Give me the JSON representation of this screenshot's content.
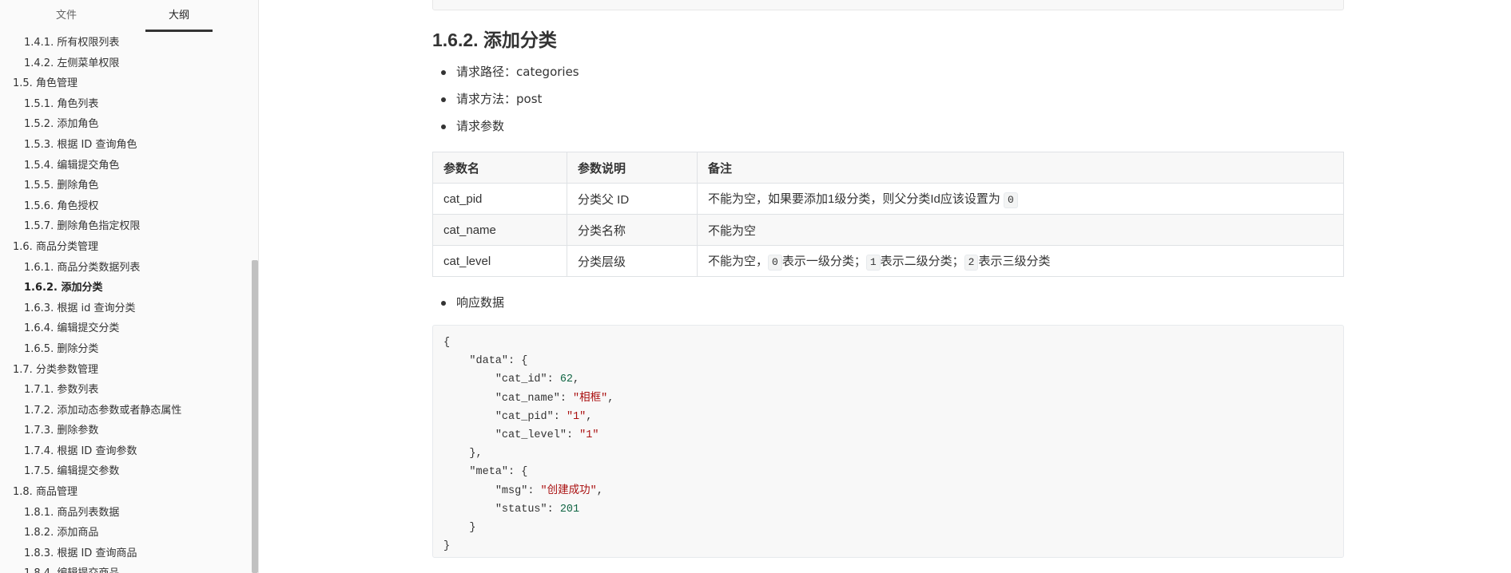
{
  "sidebar": {
    "tabs": {
      "file": "文件",
      "outline": "大纲"
    },
    "items": [
      {
        "label": "1.4.1. 所有权限列表",
        "level": 3
      },
      {
        "label": "1.4.2. 左侧菜单权限",
        "level": 3
      },
      {
        "label": "1.5. 角色管理",
        "level": 2
      },
      {
        "label": "1.5.1. 角色列表",
        "level": 3
      },
      {
        "label": "1.5.2. 添加角色",
        "level": 3
      },
      {
        "label": "1.5.3. 根据 ID 查询角色",
        "level": 3
      },
      {
        "label": "1.5.4. 编辑提交角色",
        "level": 3
      },
      {
        "label": "1.5.5. 删除角色",
        "level": 3
      },
      {
        "label": "1.5.6. 角色授权",
        "level": 3
      },
      {
        "label": "1.5.7. 删除角色指定权限",
        "level": 3
      },
      {
        "label": "1.6. 商品分类管理",
        "level": 2
      },
      {
        "label": "1.6.1. 商品分类数据列表",
        "level": 3
      },
      {
        "label": "1.6.2. 添加分类",
        "level": 3,
        "active": true
      },
      {
        "label": "1.6.3. 根据 id 查询分类",
        "level": 3
      },
      {
        "label": "1.6.4. 编辑提交分类",
        "level": 3
      },
      {
        "label": "1.6.5. 删除分类",
        "level": 3
      },
      {
        "label": "1.7. 分类参数管理",
        "level": 2
      },
      {
        "label": "1.7.1. 参数列表",
        "level": 3
      },
      {
        "label": "1.7.2. 添加动态参数或者静态属性",
        "level": 3
      },
      {
        "label": "1.7.3. 删除参数",
        "level": 3
      },
      {
        "label": "1.7.4. 根据 ID 查询参数",
        "level": 3
      },
      {
        "label": "1.7.5. 编辑提交参数",
        "level": 3
      },
      {
        "label": "1.8. 商品管理",
        "level": 2
      },
      {
        "label": "1.8.1. 商品列表数据",
        "level": 3
      },
      {
        "label": "1.8.2. 添加商品",
        "level": 3
      },
      {
        "label": "1.8.3. 根据 ID 查询商品",
        "level": 3
      },
      {
        "label": "1.8.4. 编辑提交商品",
        "level": 3
      }
    ]
  },
  "content": {
    "title": "1.6.2. 添加分类",
    "bullets": [
      "请求路径：categories",
      "请求方法：post",
      "请求参数"
    ],
    "table": {
      "headers": [
        "参数名",
        "参数说明",
        "备注"
      ],
      "rows": [
        {
          "name": "cat_pid",
          "desc": "分类父 ID",
          "note_text": "不能为空，如果要添加1级分类，则父分类Id应该设置为",
          "note_code": "0"
        },
        {
          "name": "cat_name",
          "desc": "分类名称",
          "note_text": "不能为空"
        },
        {
          "name": "cat_level",
          "desc": "分类层级",
          "code0": "0",
          "t0": "表示一级分类；",
          "code1": "1",
          "t1": "表示二级分类；",
          "code2": "2",
          "t2": "表示三级分类",
          "prefix": "不能为空，"
        }
      ]
    },
    "response_label": "响应数据",
    "code": {
      "l1": "{",
      "l2_key": "\"data\"",
      "l2_rest": ": {",
      "l3_key": "\"cat_id\"",
      "l3_val": "62",
      "l3_end": ",",
      "l4_key": "\"cat_name\"",
      "l4_val": "\"相框\"",
      "l4_end": ",",
      "l5_key": "\"cat_pid\"",
      "l5_val": "\"1\"",
      "l5_end": ",",
      "l6_key": "\"cat_level\"",
      "l6_val": "\"1\"",
      "l7": "    },",
      "l8_key": "\"meta\"",
      "l8_rest": ": {",
      "l9_key": "\"msg\"",
      "l9_val": "\"创建成功\"",
      "l9_end": ",",
      "l10_key": "\"status\"",
      "l10_val": "201",
      "l11": "    }",
      "l12": "}"
    }
  }
}
